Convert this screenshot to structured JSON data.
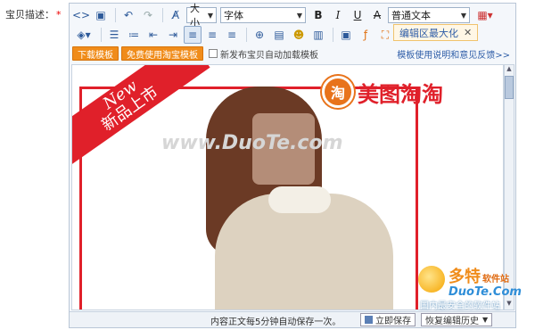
{
  "form": {
    "label": "宝贝描述：",
    "required_mark": "*"
  },
  "toolbar": {
    "font_size_label": "大小",
    "font_family_label": "字体",
    "block_format_label": "普通文本",
    "tooltip": "编辑区最大化"
  },
  "templates": {
    "download_label": "下载模板",
    "use_taobao_label": "免费使用淘宝模板",
    "auto_load_label": "新发布宝贝自动加载模板",
    "help_link": "模板使用说明和意见反馈>>"
  },
  "content": {
    "banner_en": "New",
    "banner_cn": "新品上市",
    "brand_seal": "淘",
    "brand_name": "美图淘淘",
    "watermark": "www.DuoTe.com"
  },
  "status": {
    "autosave": "内容正文每5分钟自动保存一次。",
    "save_now": "立即保存",
    "restore_history": "恢复编辑历史"
  },
  "site_logo": {
    "name": "多特",
    "sub": "软件站",
    "domain": "DuoTe.Com",
    "slogan": "国内最安全的软件站"
  },
  "colors": {
    "accent_orange": "#f08c1a",
    "banner_red": "#e0202a",
    "link_blue": "#2f5ea8"
  }
}
